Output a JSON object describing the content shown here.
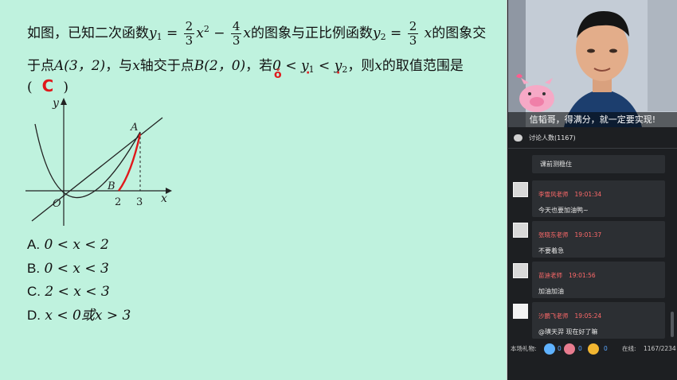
{
  "question": {
    "l1_pre": "如图，已知二次函数",
    "y1": "y",
    "y1_sub": "1",
    "eq": "=",
    "f1_num": "2",
    "f1_den": "3",
    "x2": "x",
    "x2_sup": "2",
    "minus": "−",
    "f2_num": "4",
    "f2_den": "3",
    "x_var": "x",
    "l1_mid": "的图象与正比例函数",
    "y2": "y",
    "y2_sub": "2",
    "f3_num": "2",
    "f3_den": "3",
    "l1_end": "的图象交",
    "l2_a": "于点",
    "ptA": "A(3，2)",
    "l2_b": "，与",
    "l2_x": "x",
    "l2_c": "轴交于点",
    "ptB": "B(2，0)",
    "l2_d": "，若",
    "ineq": "0 < y",
    "ineq_sub1": "1",
    "ineq_mid": " < y",
    "ineq_sub2": "2",
    "l2_e": "，则",
    "l2_x2": "x",
    "l2_f": "的取值范围是",
    "paren_open": "(",
    "answer": "C",
    "paren_close": ")"
  },
  "options": [
    {
      "letter": "A.",
      "expr": "0 < x < 2"
    },
    {
      "letter": "B.",
      "expr": "0 < x < 3"
    },
    {
      "letter": "C.",
      "expr": "2 < x < 3"
    },
    {
      "letter": "D.",
      "expr": "x < 0或x > 3"
    }
  ],
  "graph": {
    "y_label": "y",
    "x_label": "x",
    "origin": "O",
    "point_a": "A",
    "point_b": "B",
    "tick_2": "2",
    "tick_3": "3"
  },
  "video": {
    "caption": "信韬哥，得满分，就一定要实现!"
  },
  "chat": {
    "header": "讨论人数(1167)",
    "first_message": "课前测稳住",
    "messages": [
      {
        "name": "李雪风老师",
        "time": "19:01:34",
        "text": "今天也要加油鸭~"
      },
      {
        "name": "张晓东老师",
        "time": "19:01:37",
        "text": "不要着急"
      },
      {
        "name": "苗迪老师",
        "time": "19:01:56",
        "text": "加油加油"
      },
      {
        "name": "沙鹏飞老师",
        "time": "19:05:24",
        "text": "@璜天羿 现在好了嘛"
      }
    ]
  },
  "footer": {
    "gifts_label": "本场礼物:",
    "gift1": "0",
    "gift2": "0",
    "gift3": "0",
    "online_label": "在线:",
    "online_count": "1167/2234"
  },
  "colors": {
    "board": "#bff2de",
    "answer_red": "#e0191b",
    "panel": "#1d1f22",
    "teacher_name": "#ff6a6a"
  }
}
